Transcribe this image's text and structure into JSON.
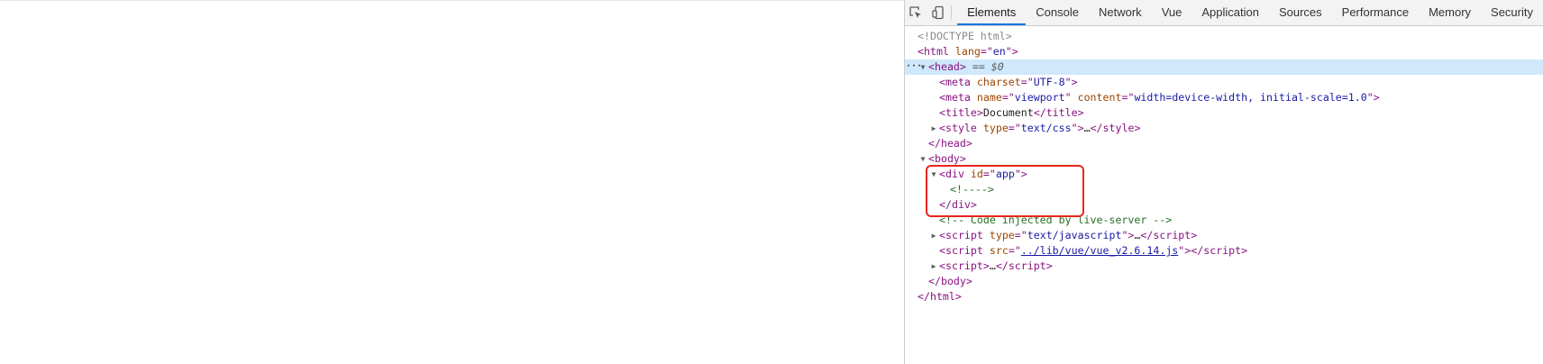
{
  "toolbar": {
    "tabs": [
      {
        "label": "Elements",
        "active": true
      },
      {
        "label": "Console"
      },
      {
        "label": "Network"
      },
      {
        "label": "Vue"
      },
      {
        "label": "Application"
      },
      {
        "label": "Sources"
      },
      {
        "label": "Performance"
      },
      {
        "label": "Memory"
      },
      {
        "label": "Security"
      }
    ]
  },
  "dom": {
    "doctype": "<!DOCTYPE html>",
    "html_open": {
      "tag": "html",
      "attr": "lang",
      "value": "en"
    },
    "head_open": {
      "tag": "head",
      "suffix": " == $0"
    },
    "meta_charset": {
      "tag": "meta",
      "attr": "charset",
      "value": "UTF-8"
    },
    "meta_viewport": {
      "tag": "meta",
      "attr1": "name",
      "value1": "viewport",
      "attr2": "content",
      "value2": "width=device-width, initial-scale=1.0"
    },
    "title": {
      "tag": "title",
      "text": "Document"
    },
    "style": {
      "tag": "style",
      "attr": "type",
      "value": "text/css"
    },
    "head_close": "</head>",
    "body_open": "body",
    "div_app": {
      "tag": "div",
      "attr": "id",
      "value": "app"
    },
    "app_comment": "<!---->",
    "div_close": "</div>",
    "live_comment": "<!-- Code injected by live-server -->",
    "script1": {
      "tag": "script",
      "attr": "type",
      "value": "text/javascript"
    },
    "script2": {
      "tag": "script",
      "attr": "src",
      "value": "../lib/vue/vue_v2.6.14.js"
    },
    "script3": {
      "tag": "script"
    },
    "body_close": "</body>",
    "html_close": "</html>"
  },
  "colors": {
    "highlight": "#e8261d",
    "selected_row": "#cfe8fc",
    "active_tab": "#1a73e8"
  }
}
